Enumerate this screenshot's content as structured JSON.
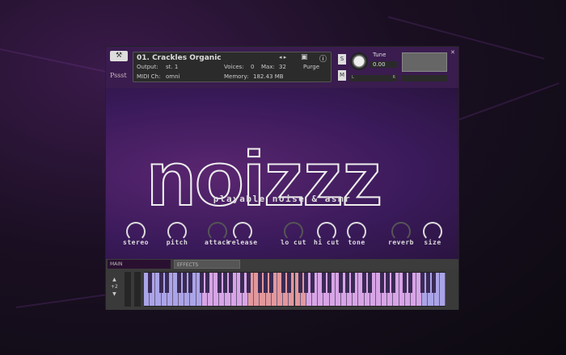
{
  "header": {
    "instrument_name": "01. Crackles Organic",
    "output_label": "Output:",
    "output_value": "st. 1",
    "voices_label": "Voices:",
    "voices_value": "0",
    "max_label": "Max:",
    "max_value": "32",
    "midi_label": "MIDI Ch:",
    "midi_value": "omni",
    "memory_label": "Memory:",
    "memory_value": "182.43 MB",
    "purge_label": "Purge",
    "solo": "S",
    "mute": "M",
    "tune_label": "Tune",
    "tune_value": "0.00",
    "pan_l": "L",
    "pan_r": "R",
    "logo": "Pssst"
  },
  "panel": {
    "title": "noizzz",
    "subtitle": "playable noise & asmr",
    "knobs": [
      {
        "label": "stereo",
        "active": true
      },
      {
        "label": "pitch",
        "active": true
      },
      {
        "label": "attack",
        "active": false
      },
      {
        "label": "release",
        "active": true
      },
      {
        "label": "lo cut",
        "active": false
      },
      {
        "label": "hi cut",
        "active": true
      },
      {
        "label": "tone",
        "active": true
      },
      {
        "label": "reverb",
        "active": false
      },
      {
        "label": "size",
        "active": true
      }
    ]
  },
  "tabs": {
    "main": "MAIN",
    "effects": "EFFECTS"
  },
  "keyboard": {
    "octave": "+2"
  },
  "colors": {
    "accent": "#3a1c4f",
    "keys_blue": "#aaa4e8",
    "keys_pink": "#d8a4e6",
    "keys_red": "#e2989c"
  }
}
